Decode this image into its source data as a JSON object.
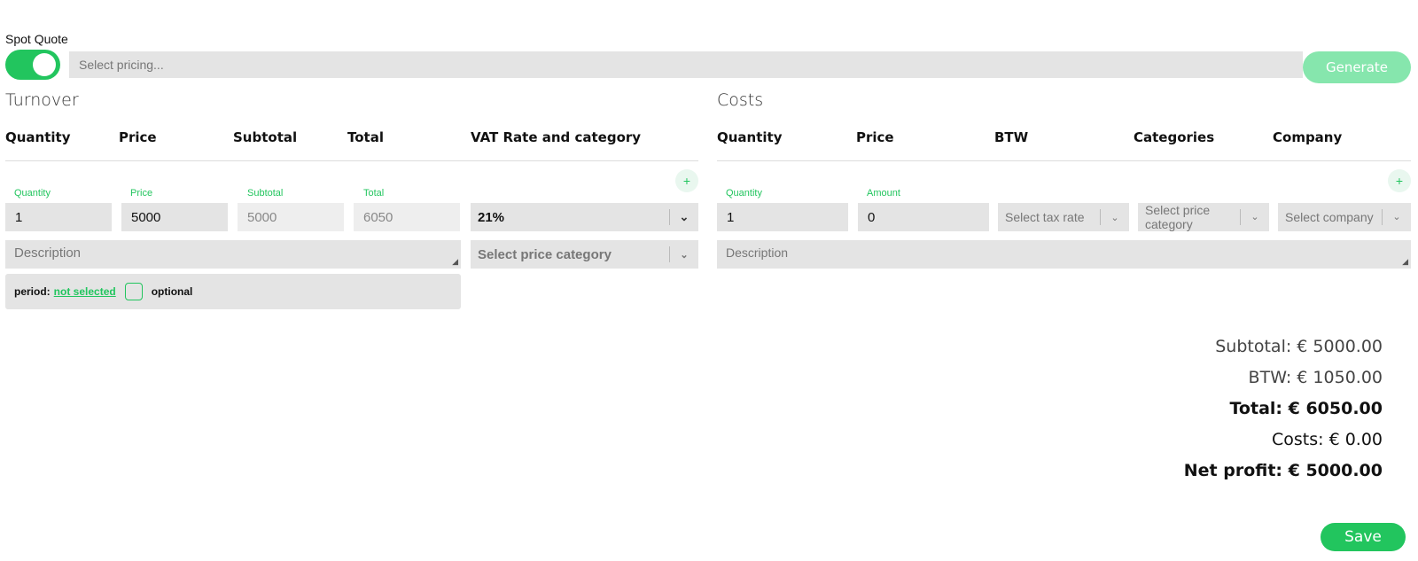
{
  "spot_quote": {
    "label": "Spot Quote",
    "toggle_on": true
  },
  "pricing": {
    "placeholder": "Select pricing..."
  },
  "generate_label": "Generate",
  "turnover": {
    "title": "Turnover",
    "columns": [
      "Quantity",
      "Price",
      "Subtotal",
      "Total",
      "VAT Rate and category"
    ],
    "row": {
      "quantity_label": "Quantity",
      "quantity": "1",
      "price_label": "Price",
      "price": "5000",
      "subtotal_label": "Subtotal",
      "subtotal": "5000",
      "total_label": "Total",
      "total": "6050",
      "vat": "21%",
      "price_category_placeholder": "Select price category",
      "description_placeholder": "Description",
      "period_label": "period:",
      "period_value": "not selected",
      "optional_label": "optional"
    },
    "add_label": "+"
  },
  "costs": {
    "title": "Costs",
    "columns": [
      "Quantity",
      "Price",
      "BTW",
      "Categories",
      "Company"
    ],
    "row": {
      "quantity_label": "Quantity",
      "quantity": "1",
      "amount_label": "Amount",
      "amount": "0",
      "tax_placeholder": "Select tax rate",
      "price_category_placeholder": "Select price category",
      "company_placeholder": "Select company",
      "description_placeholder": "Description"
    },
    "add_label": "+"
  },
  "summary": {
    "subtotal": "Subtotal: € 5000.00",
    "btw": "BTW: € 1050.00",
    "total": "Total: € 6050.00",
    "costs": "Costs: € 0.00",
    "net_profit": "Net profit: € 5000.00"
  },
  "save_label": "Save",
  "colors": {
    "accent": "#22c55e",
    "accent_light": "#86e6ad",
    "field_bg": "#e4e4e4"
  }
}
